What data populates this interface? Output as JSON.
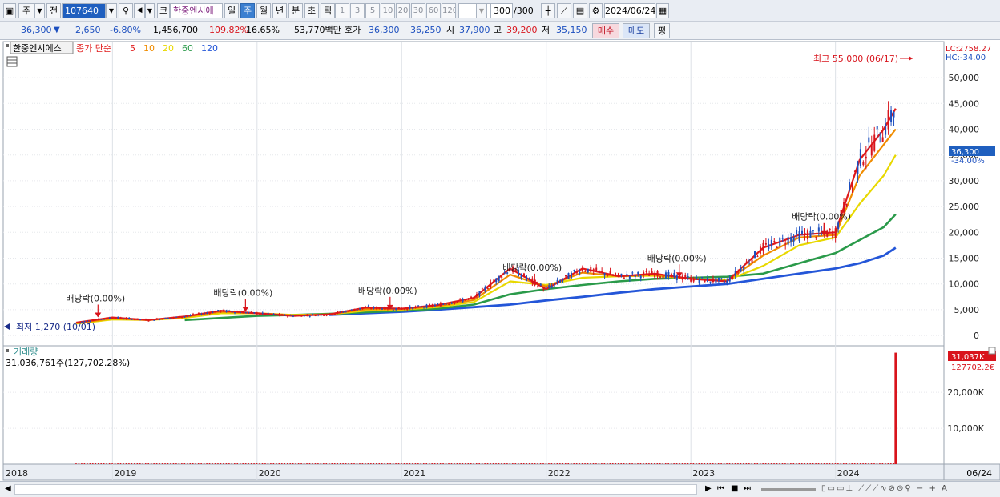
{
  "toolbar": {
    "market": "주",
    "prev_label": "전",
    "code": "107640",
    "name": "한중엔시에",
    "periods": [
      "일",
      "주",
      "월",
      "년",
      "분",
      "초",
      "틱"
    ],
    "selected_period": "주",
    "intervals": [
      "1",
      "3",
      "5",
      "10",
      "20",
      "30",
      "60",
      "120"
    ],
    "count": "300",
    "count_total": "/300",
    "date": "2024/06/24"
  },
  "quote": {
    "price": "36,300",
    "change_arrow": "▼",
    "change": "2,650",
    "change_pct": "-6.80%",
    "volume": "1,456,700",
    "volume_ratio": "109.82%",
    "turnover": "16.65%",
    "amount": "53,770백만",
    "hoga_label": "호가",
    "ask": "36,300",
    "bid": "36,250",
    "open_label": "시",
    "open": "37,900",
    "high_label": "고",
    "high": "39,200",
    "low_label": "저",
    "low": "35,150",
    "buy_label": "매수",
    "sell_label": "매도",
    "avg_label": "평"
  },
  "price_panel": {
    "stock_label": "한중엔시에스",
    "ma_title": "종가 단순",
    "ma_periods": [
      {
        "label": "5",
        "color": "#e01a1a"
      },
      {
        "label": "10",
        "color": "#f08c00"
      },
      {
        "label": "20",
        "color": "#e8d800"
      },
      {
        "label": "60",
        "color": "#2a9a4a"
      },
      {
        "label": "120",
        "color": "#2456d8"
      }
    ],
    "lc_label": "LC:2758.27",
    "hc_label": "HC:-34.00",
    "max_note": "최고 55,000 (06/17)",
    "min_note": "최저 1,270 (10/01)",
    "current_price_tag": "36,300",
    "current_pct_tag": "-34.00%",
    "dividend_labels": [
      "배당락(0.00%)",
      "배당락(0.00%)",
      "배당락(0.00%)",
      "배당락(0.00%)",
      "배당락(0.00%)",
      "배당락(0.00%)"
    ]
  },
  "volume_panel": {
    "title": "거래량",
    "value_text": "31,036,761주(127,702.28%)",
    "tag_value": "31,037K",
    "tag_pct": "127702.2€",
    "y_ticks": [
      "20,000K",
      "10,000K"
    ]
  },
  "x_axis": {
    "labels": [
      "2018",
      "2019",
      "2020",
      "2021",
      "2022",
      "2023",
      "2024"
    ],
    "end_label": "06/24"
  },
  "chart_data": {
    "type": "line",
    "title": "",
    "ylabel": "",
    "ylim": [
      -2000,
      57000
    ],
    "y_ticks": [
      0,
      5000,
      10000,
      15000,
      20000,
      25000,
      30000,
      35000,
      40000,
      45000,
      50000
    ],
    "x_ticks": [
      "2018",
      "2019",
      "2020",
      "2021",
      "2022",
      "2023",
      "2024"
    ],
    "x": [
      "2018-10",
      "2019-01",
      "2019-04",
      "2019-07",
      "2019-10",
      "2020-01",
      "2020-04",
      "2020-07",
      "2020-10",
      "2021-01",
      "2021-04",
      "2021-07",
      "2021-10",
      "2022-01",
      "2022-04",
      "2022-07",
      "2022-10",
      "2023-01",
      "2023-04",
      "2023-07",
      "2023-10",
      "2024-01",
      "2024-03",
      "2024-05",
      "2024-06"
    ],
    "series": [
      {
        "name": "5",
        "values": [
          2500,
          3500,
          3000,
          3700,
          4800,
          4300,
          3800,
          4100,
          5400,
          5200,
          5900,
          7300,
          13000,
          9000,
          13000,
          11500,
          12000,
          11000,
          10500,
          17000,
          19500,
          20000,
          34000,
          40000,
          44000
        ]
      },
      {
        "name": "10",
        "values": [
          2400,
          3300,
          3000,
          3600,
          4600,
          4300,
          3900,
          4100,
          5100,
          5100,
          5700,
          6900,
          11800,
          9500,
          12200,
          11500,
          11800,
          11000,
          10600,
          15500,
          19000,
          19500,
          31000,
          37000,
          40000
        ]
      },
      {
        "name": "20",
        "values": [
          2300,
          3100,
          3000,
          3400,
          4300,
          4300,
          4000,
          4100,
          4800,
          5000,
          5500,
          6500,
          10500,
          9800,
          11200,
          11500,
          11600,
          11000,
          10700,
          13500,
          17500,
          19000,
          25500,
          31000,
          35000
        ]
      },
      {
        "name": "60",
        "values": [
          null,
          null,
          null,
          3000,
          3400,
          3800,
          4000,
          4200,
          4500,
          4800,
          5200,
          6000,
          8000,
          9000,
          9800,
          10500,
          11000,
          11200,
          11400,
          12000,
          14000,
          16000,
          18500,
          21000,
          23500
        ]
      },
      {
        "name": "120",
        "values": [
          null,
          null,
          null,
          null,
          null,
          null,
          null,
          4000,
          4300,
          4600,
          5000,
          5500,
          6000,
          6800,
          7500,
          8300,
          9000,
          9500,
          10000,
          11000,
          12000,
          13000,
          14000,
          15500,
          17000
        ]
      }
    ]
  }
}
